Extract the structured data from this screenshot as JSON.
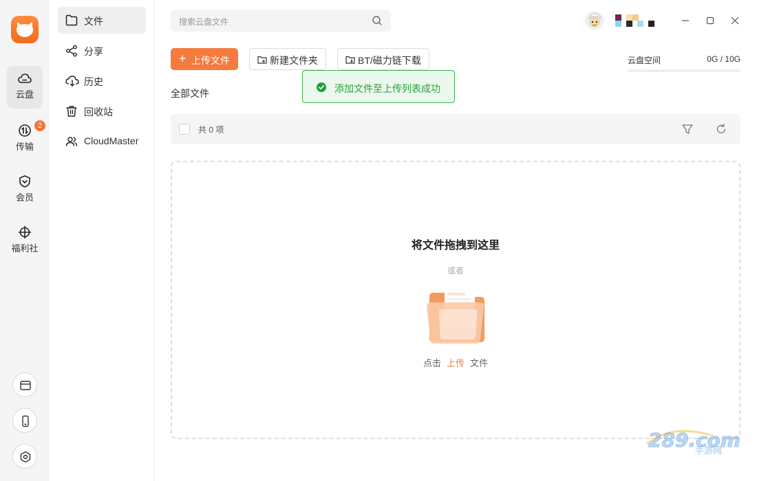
{
  "rail": {
    "items": [
      {
        "label": "云盘"
      },
      {
        "label": "传输",
        "badge": "2"
      },
      {
        "label": "会员"
      },
      {
        "label": "福利社"
      }
    ]
  },
  "nav": {
    "items": [
      {
        "label": "文件"
      },
      {
        "label": "分享"
      },
      {
        "label": "历史"
      },
      {
        "label": "回收站"
      },
      {
        "label": "CloudMaster"
      }
    ]
  },
  "search": {
    "placeholder": "搜索云盘文件"
  },
  "toolbar": {
    "upload_label": "上传文件",
    "new_folder_label": "新建文件夹",
    "bt_label": "BT/磁力链下载"
  },
  "storage": {
    "label": "云盘空间",
    "value": "0G / 10G",
    "used_fraction": 0
  },
  "toast": {
    "message": "添加文件至上传列表成功"
  },
  "breadcrumb": {
    "label": "全部文件"
  },
  "list": {
    "count_text": "共 0 项"
  },
  "dropzone": {
    "title": "将文件拖拽到这里",
    "or_text": "或者",
    "action_prefix": "点击",
    "action_link": "上传",
    "action_suffix": "文件"
  },
  "watermark": {
    "brand": "289.com",
    "sub": "手游网"
  },
  "colors": {
    "accent": "#f47a3d",
    "success": "#3ab54a",
    "success_bg": "#ebf8ed"
  }
}
